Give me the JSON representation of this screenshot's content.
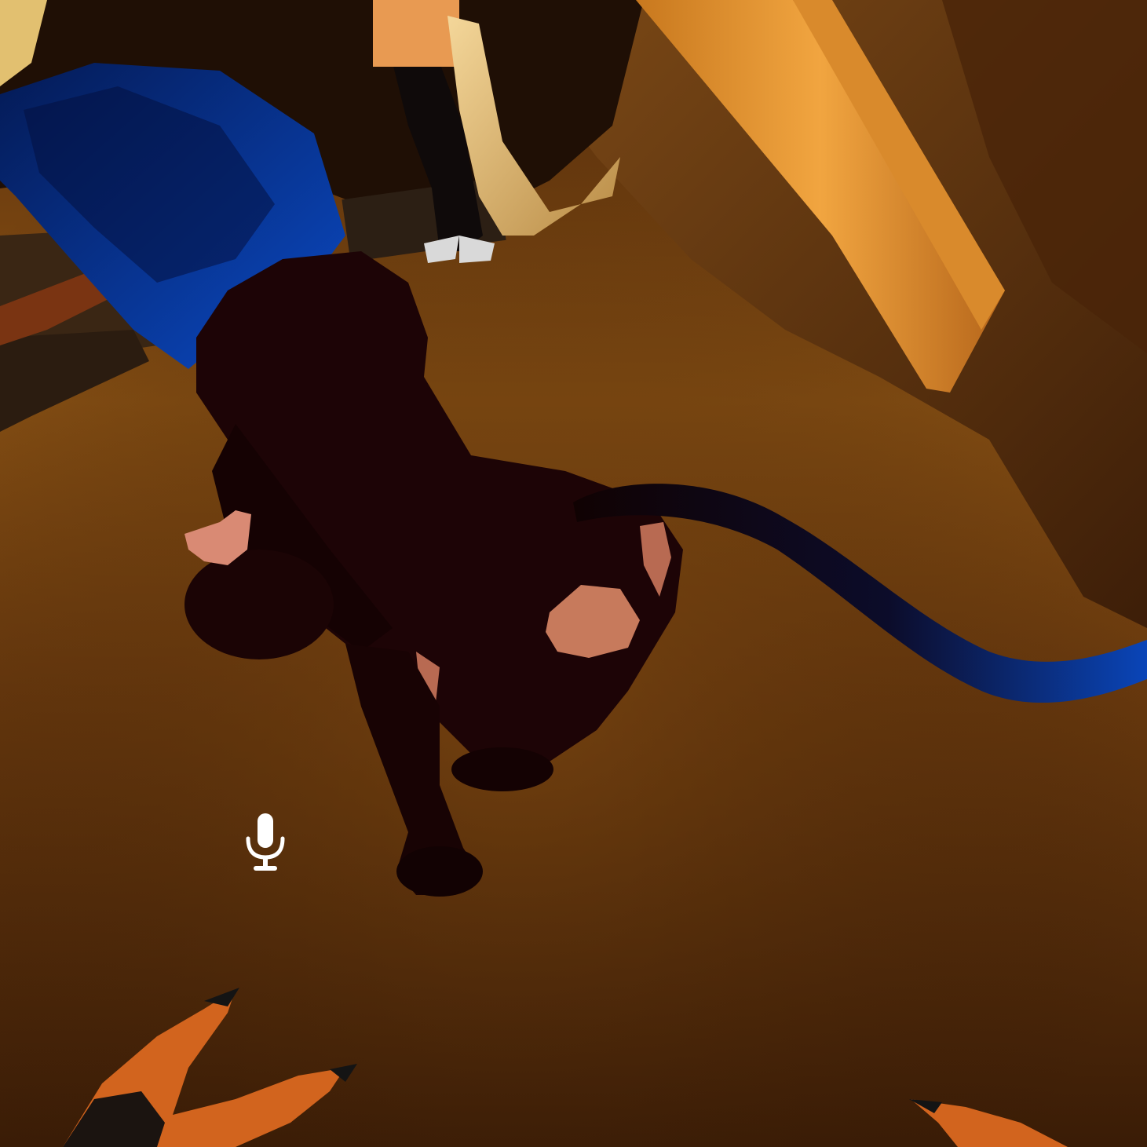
{
  "scene": {
    "description_icon": "vr-room-view",
    "colors": {
      "floor_light": "#b8731a",
      "floor_dark": "#3a1c06",
      "wall": "#6b3d12",
      "pillar": "#e5902f",
      "avatar_body": "#1a0505",
      "avatar_hair": "#0a3a9e",
      "skin": "#d9826a"
    }
  },
  "hud": {
    "mic_icon": "microphone-icon",
    "mic_color": "#ffffff"
  }
}
